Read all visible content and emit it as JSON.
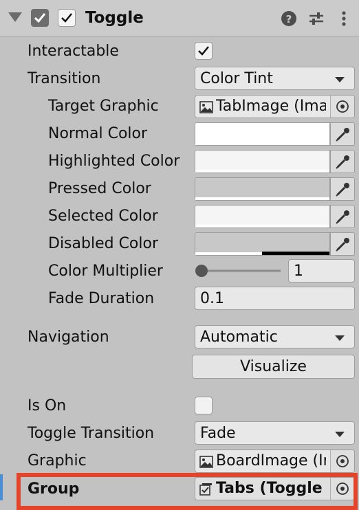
{
  "header": {
    "title": "Toggle",
    "help_icon": "help-icon",
    "presets_icon": "presets-icon",
    "menu_icon": "kebab-menu-icon"
  },
  "properties": {
    "interactable": {
      "label": "Interactable",
      "checked": true
    },
    "transition": {
      "label": "Transition",
      "value": "Color Tint"
    },
    "target_graphic": {
      "label": "Target Graphic",
      "value": "TabImage (Ima"
    },
    "normal_color": {
      "label": "Normal Color",
      "color": "#ffffff"
    },
    "highlighted_color": {
      "label": "Highlighted Color",
      "color": "#f5f5f5"
    },
    "pressed_color": {
      "label": "Pressed Color",
      "color": "#c8c8c8"
    },
    "selected_color": {
      "label": "Selected Color",
      "color": "#f5f5f5"
    },
    "disabled_color": {
      "label": "Disabled Color",
      "color": "#c8c8c8",
      "alpha": 0.5
    },
    "color_multiplier": {
      "label": "Color Multiplier",
      "value": "1",
      "slider_fraction": 0
    },
    "fade_duration": {
      "label": "Fade Duration",
      "value": "0.1"
    },
    "navigation": {
      "label": "Navigation",
      "value": "Automatic"
    },
    "visualize_button": "Visualize",
    "is_on": {
      "label": "Is On",
      "checked": false
    },
    "toggle_transition": {
      "label": "Toggle Transition",
      "value": "Fade"
    },
    "graphic": {
      "label": "Graphic",
      "value": "BoardImage (In"
    },
    "group": {
      "label": "Group",
      "value": "Tabs (Toggle"
    }
  },
  "colors": {
    "highlight_border": "#e4442a",
    "selection_marker": "#4a8fd6"
  }
}
